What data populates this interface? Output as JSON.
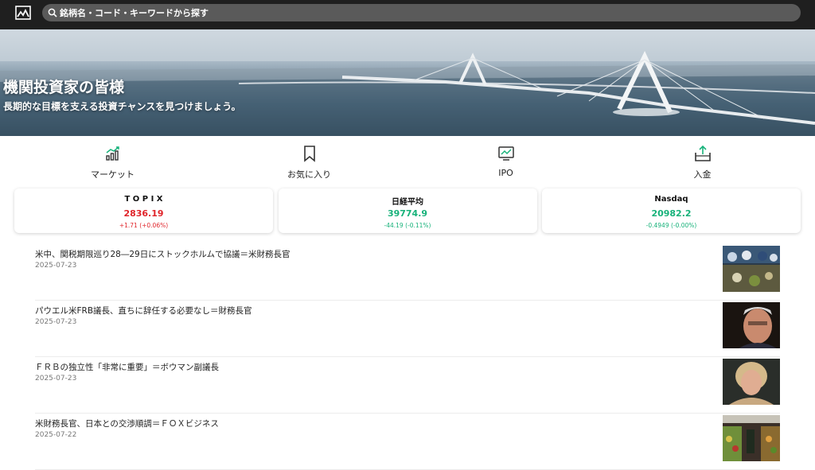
{
  "search": {
    "placeholder": "銘柄名・コード・キーワードから探す"
  },
  "banner": {
    "title": "機関投資家の皆様",
    "subtitle": "長期的な目標を支える投資チャンスを見つけましょう。"
  },
  "quick_nav": [
    {
      "label": "マーケット",
      "icon": "market-chart-icon"
    },
    {
      "label": "お気に入り",
      "icon": "bookmark-icon"
    },
    {
      "label": "IPO",
      "icon": "monitor-chart-icon"
    },
    {
      "label": "入金",
      "icon": "deposit-icon"
    }
  ],
  "indices": [
    {
      "name": "T O P I X",
      "value": "2836.19",
      "change": "+1.71 (+0.06%)",
      "trend": "up"
    },
    {
      "name": "日経平均",
      "value": "39774.9",
      "change": "-44.19 (-0.11%)",
      "trend": "down"
    },
    {
      "name": "Nasdaq",
      "value": "20982.2",
      "change": "-0.4949 (-0.00%)",
      "trend": "down"
    }
  ],
  "colors": {
    "up": "#e0242a",
    "down": "#17b27a",
    "topbar": "#1f1f1f"
  },
  "news": [
    {
      "title": "米中、関税期限巡り28―29日にストックホルムで協議＝米財務長官",
      "date": "2025-07-23"
    },
    {
      "title": "パウエル米FRB議長、直ちに辞任する必要なし＝財務長官",
      "date": "2025-07-23"
    },
    {
      "title": "ＦＲＢの独立性「非常に重要」＝ボウマン副議長",
      "date": "2025-07-23"
    },
    {
      "title": "米財務長官、日本との交渉順調＝ＦＯＸビジネス",
      "date": "2025-07-22"
    }
  ]
}
